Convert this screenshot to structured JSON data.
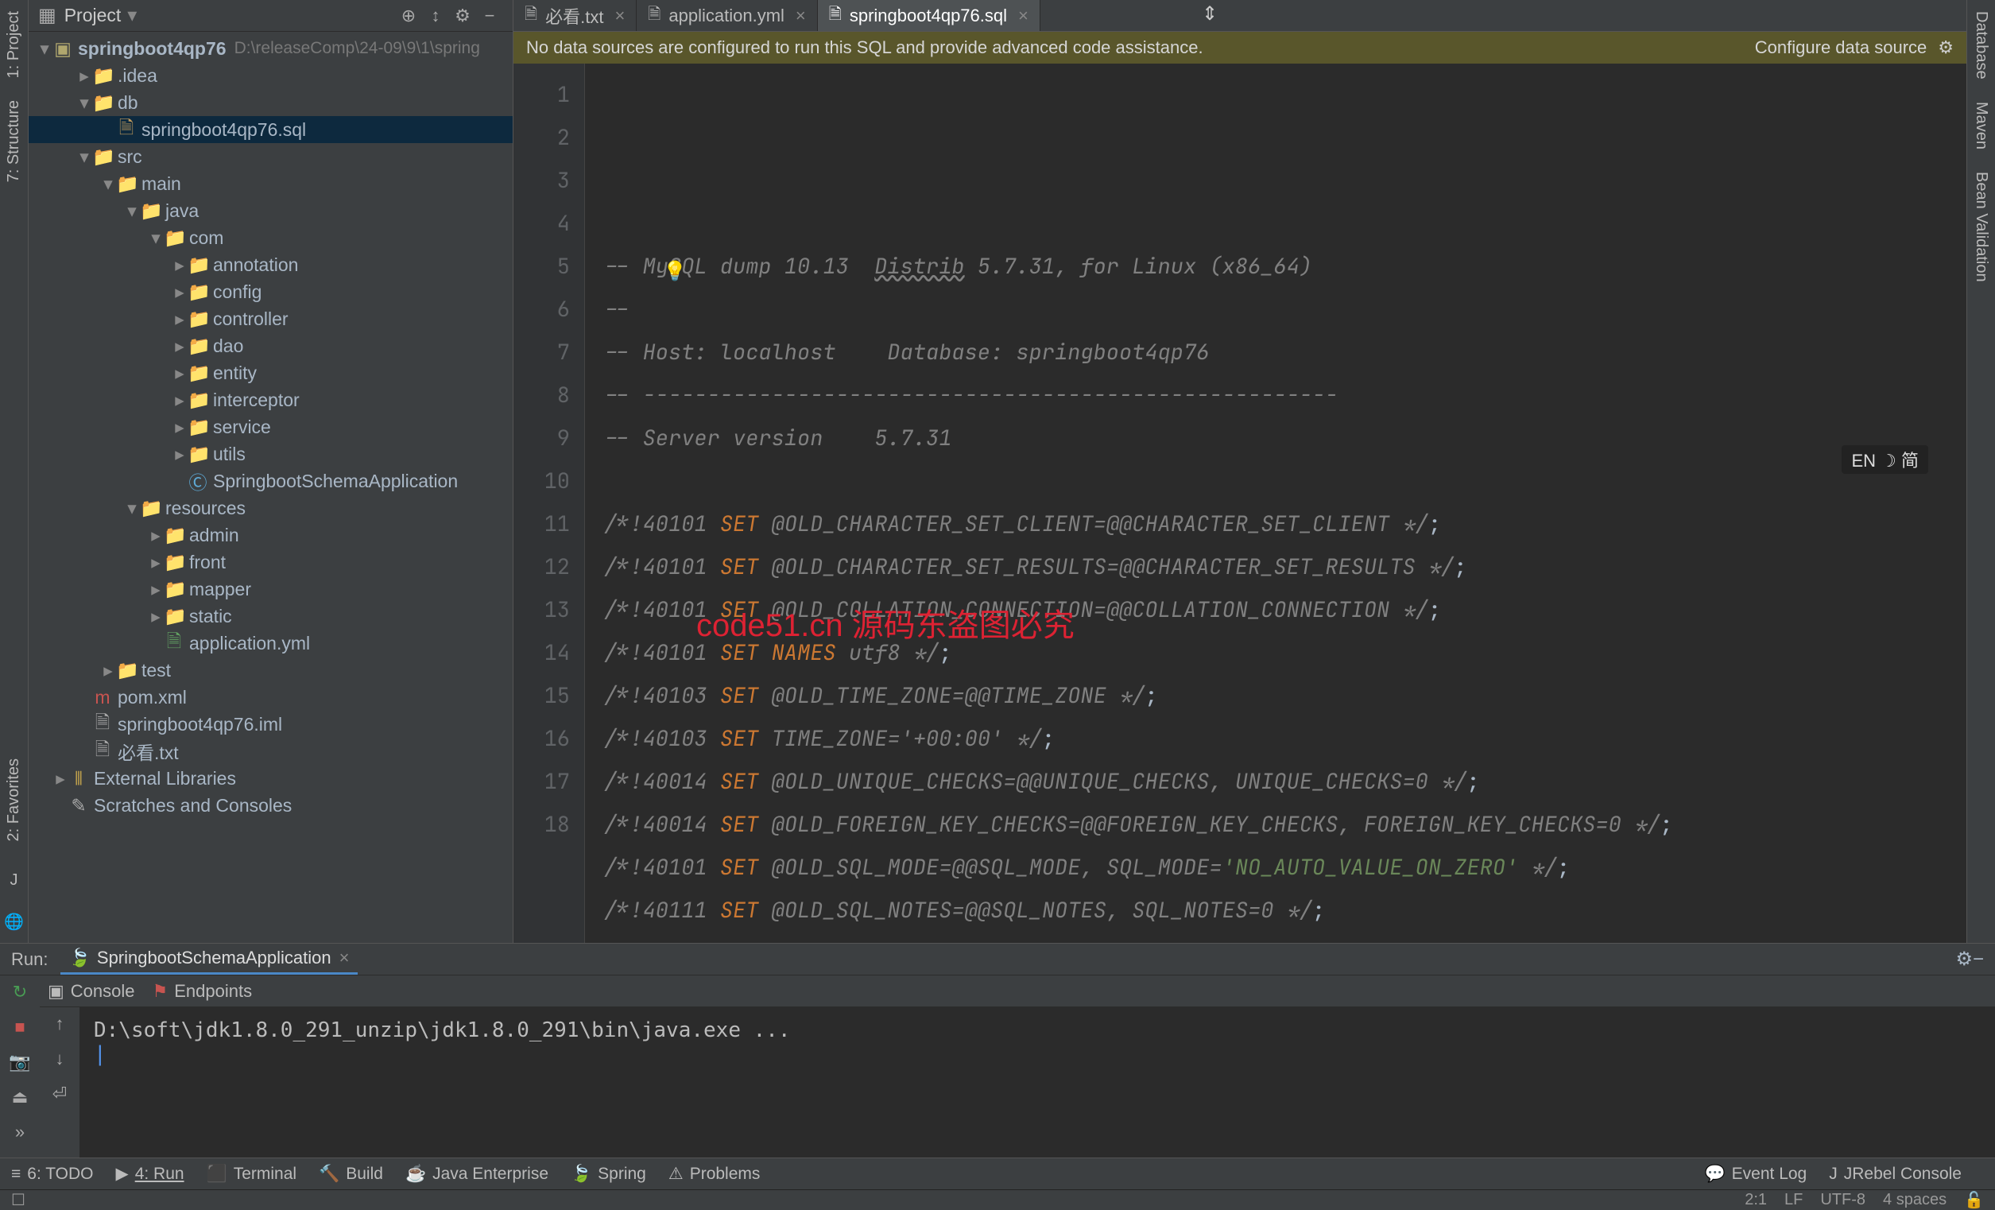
{
  "sidebar": {
    "title": "Project",
    "hdr_icons": [
      "⊕",
      "↕",
      "⚙",
      "−"
    ],
    "root": {
      "name": "springboot4qp76",
      "path": "D:\\releaseComp\\24-09\\9\\1\\spring"
    },
    "nodes": [
      {
        "indent": 1,
        "chev": "▸",
        "icon": "📁",
        "label": ".idea",
        "cls": "ic-folder"
      },
      {
        "indent": 1,
        "chev": "▾",
        "icon": "📁",
        "label": "db",
        "cls": "ic-folder"
      },
      {
        "indent": 2,
        "chev": "",
        "icon": "🗎",
        "label": "springboot4qp76.sql",
        "cls": "ic-sql",
        "sel": true
      },
      {
        "indent": 1,
        "chev": "▾",
        "icon": "📁",
        "label": "src",
        "cls": "ic-folder-sp"
      },
      {
        "indent": 2,
        "chev": "▾",
        "icon": "📁",
        "label": "main",
        "cls": "ic-folder-sp"
      },
      {
        "indent": 3,
        "chev": "▾",
        "icon": "📁",
        "label": "java",
        "cls": "ic-folder-sp"
      },
      {
        "indent": 4,
        "chev": "▾",
        "icon": "📁",
        "label": "com",
        "cls": "ic-folder"
      },
      {
        "indent": 5,
        "chev": "▸",
        "icon": "📁",
        "label": "annotation",
        "cls": "ic-folder"
      },
      {
        "indent": 5,
        "chev": "▸",
        "icon": "📁",
        "label": "config",
        "cls": "ic-folder"
      },
      {
        "indent": 5,
        "chev": "▸",
        "icon": "📁",
        "label": "controller",
        "cls": "ic-folder"
      },
      {
        "indent": 5,
        "chev": "▸",
        "icon": "📁",
        "label": "dao",
        "cls": "ic-folder"
      },
      {
        "indent": 5,
        "chev": "▸",
        "icon": "📁",
        "label": "entity",
        "cls": "ic-folder"
      },
      {
        "indent": 5,
        "chev": "▸",
        "icon": "📁",
        "label": "interceptor",
        "cls": "ic-folder"
      },
      {
        "indent": 5,
        "chev": "▸",
        "icon": "📁",
        "label": "service",
        "cls": "ic-folder"
      },
      {
        "indent": 5,
        "chev": "▸",
        "icon": "📁",
        "label": "utils",
        "cls": "ic-folder"
      },
      {
        "indent": 5,
        "chev": "",
        "icon": "Ⓒ",
        "label": "SpringbootSchemaApplication",
        "cls": "ic-class"
      },
      {
        "indent": 3,
        "chev": "▾",
        "icon": "📁",
        "label": "resources",
        "cls": "ic-folder-sp"
      },
      {
        "indent": 4,
        "chev": "▸",
        "icon": "📁",
        "label": "admin",
        "cls": "ic-folder"
      },
      {
        "indent": 4,
        "chev": "▸",
        "icon": "📁",
        "label": "front",
        "cls": "ic-folder"
      },
      {
        "indent": 4,
        "chev": "▸",
        "icon": "📁",
        "label": "mapper",
        "cls": "ic-folder"
      },
      {
        "indent": 4,
        "chev": "▸",
        "icon": "📁",
        "label": "static",
        "cls": "ic-folder"
      },
      {
        "indent": 4,
        "chev": "",
        "icon": "🗎",
        "label": "application.yml",
        "cls": "ic-yml"
      },
      {
        "indent": 2,
        "chev": "▸",
        "icon": "📁",
        "label": "test",
        "cls": "ic-folder-sp"
      },
      {
        "indent": 1,
        "chev": "",
        "icon": "m",
        "label": "pom.xml",
        "cls": "ic-xml"
      },
      {
        "indent": 1,
        "chev": "",
        "icon": "🗎",
        "label": "springboot4qp76.iml",
        "cls": "ic-file"
      },
      {
        "indent": 1,
        "chev": "",
        "icon": "🗎",
        "label": "必看.txt",
        "cls": "ic-file"
      },
      {
        "indent": 0,
        "chev": "▸",
        "icon": "⫴",
        "label": "External Libraries",
        "cls": "ic-lib"
      },
      {
        "indent": 0,
        "chev": "",
        "icon": "✎",
        "label": "Scratches and Consoles",
        "cls": "ic-file"
      }
    ]
  },
  "tabs": [
    {
      "icon": "🗎",
      "label": "必看.txt",
      "active": false
    },
    {
      "icon": "🗎",
      "label": "application.yml",
      "active": false
    },
    {
      "icon": "🗎",
      "label": "springboot4qp76.sql",
      "active": true
    }
  ],
  "banner": {
    "msg": "No data sources are configured to run this SQL and provide advanced code assistance.",
    "action": "Configure data source"
  },
  "code_lines": [
    {
      "n": 1,
      "html": "<span class='c-comment'>-- MySQL dump 10.13  <span class='c-under'>Distrib</span> 5.7.31, for Linux (x86_64)</span>"
    },
    {
      "n": 2,
      "html": "<span class='c-comment'>--</span>"
    },
    {
      "n": 3,
      "html": "<span class='c-comment'>-- Host: localhost    Database: springboot4qp76</span>"
    },
    {
      "n": 4,
      "html": "<span class='c-comment'>-- ------------------------------------------------------</span>"
    },
    {
      "n": 5,
      "html": "<span class='c-comment'>-- Server version    5.7.31</span>"
    },
    {
      "n": 6,
      "html": ""
    },
    {
      "n": 7,
      "html": "<span class='c-comment'>/*!40101 <span class='c-kw'>SET</span> @OLD_CHARACTER_SET_CLIENT=@@CHARACTER_SET_CLIENT */</span><span class='c-txt'>;</span>"
    },
    {
      "n": 8,
      "html": "<span class='c-comment'>/*!40101 <span class='c-kw'>SET</span> @OLD_CHARACTER_SET_RESULTS=@@CHARACTER_SET_RESULTS */</span><span class='c-txt'>;</span>"
    },
    {
      "n": 9,
      "html": "<span class='c-comment'>/*!40101 <span class='c-kw'>SET</span> @OLD_COLLATION_CONNECTION=@@COLLATION_CONNECTION */</span><span class='c-txt'>;</span>"
    },
    {
      "n": 10,
      "html": "<span class='c-comment'>/*!40101 <span class='c-kw'>SET NAMES</span> utf8 */</span><span class='c-txt'>;</span>"
    },
    {
      "n": 11,
      "html": "<span class='c-comment'>/*!40103 <span class='c-kw'>SET</span> @OLD_TIME_ZONE=@@TIME_ZONE */</span><span class='c-txt'>;</span>"
    },
    {
      "n": 12,
      "html": "<span class='c-comment'>/*!40103 <span class='c-kw'>SET</span> TIME_ZONE='+00:00' */</span><span class='c-txt'>;</span>"
    },
    {
      "n": 13,
      "html": "<span class='c-comment'>/*!40014 <span class='c-kw'>SET</span> @OLD_UNIQUE_CHECKS=@@UNIQUE_CHECKS, UNIQUE_CHECKS=0 */</span><span class='c-txt'>;</span>"
    },
    {
      "n": 14,
      "html": "<span class='c-comment'>/*!40014 <span class='c-kw'>SET</span> @OLD_FOREIGN_KEY_CHECKS=@@FOREIGN_KEY_CHECKS, FOREIGN_KEY_CHECKS=0 */</span><span class='c-txt'>;</span>"
    },
    {
      "n": 15,
      "html": "<span class='c-comment'>/*!40101 <span class='c-kw'>SET</span> @OLD_SQL_MODE=@@SQL_MODE, SQL_MODE=<span class='c-str'>'NO_AUTO_VALUE_ON_ZERO'</span> */</span><span class='c-txt'>;</span>"
    },
    {
      "n": 16,
      "html": "<span class='c-comment'>/*!40111 <span class='c-kw'>SET</span> @OLD_SQL_NOTES=@@SQL_NOTES, SQL_NOTES=0 */</span><span class='c-txt'>;</span>"
    },
    {
      "n": 17,
      "html": ""
    },
    {
      "n": 18,
      "html": "<span class='c-comment'>--</span>"
    }
  ],
  "left_tabs": [
    "1: Project",
    "7: Structure"
  ],
  "left_tabs2": [
    "2: Favorites"
  ],
  "right_tabs": [
    "Database",
    "Maven",
    "Bean Validation"
  ],
  "left_icons": [
    "J",
    "🌐"
  ],
  "run": {
    "label": "Run:",
    "config": "SpringbootSchemaApplication",
    "tabs": [
      "Console",
      "Endpoints"
    ],
    "console": "D:\\soft\\jdk1.8.0_291_unzip\\jdk1.8.0_291\\bin\\java.exe ..."
  },
  "bottom": {
    "items": [
      {
        "ic": "≡",
        "label": "6: TODO"
      },
      {
        "ic": "▶",
        "label": "4: Run",
        "u": true
      },
      {
        "ic": "⬛",
        "label": "Terminal"
      },
      {
        "ic": "🔨",
        "label": "Build"
      },
      {
        "ic": "☕",
        "label": "Java Enterprise"
      },
      {
        "ic": "🍃",
        "label": "Spring"
      },
      {
        "ic": "⚠",
        "label": "Problems"
      }
    ],
    "right": [
      {
        "ic": "💬",
        "label": "Event Log"
      },
      {
        "ic": "J",
        "label": "JRebel Console"
      }
    ]
  },
  "status": {
    "pos": "2:1",
    "lf": "LF",
    "enc": "UTF-8",
    "ind": "4 spaces",
    "lock": "🔓"
  },
  "watermark": "code51.cn 源码东盗图必究",
  "ime": "EN ☽ 简"
}
